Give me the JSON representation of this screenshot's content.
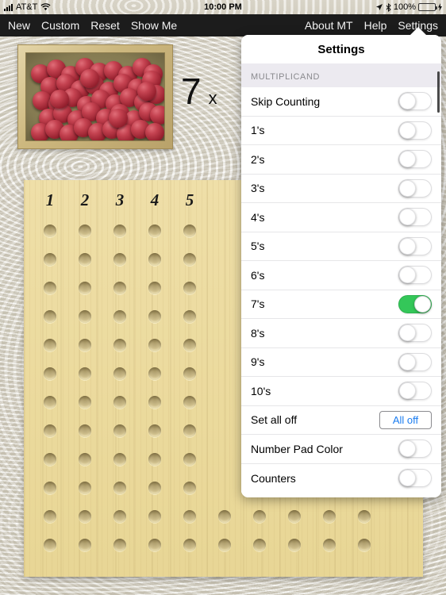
{
  "statusbar": {
    "signal_icon": "cellular-bars-icon",
    "carrier": "AT&T",
    "wifi_icon": "wifi-icon",
    "time": "10:00 PM",
    "location_icon": "location-arrow-icon",
    "bluetooth_icon": "bluetooth-icon",
    "battery_percent": "100%",
    "battery_icon": "battery-icon",
    "charging_icon": "lightning-bolt-icon"
  },
  "toolbar": {
    "left_items": [
      {
        "label": "New",
        "name": "new-button"
      },
      {
        "label": "Custom",
        "name": "custom-button"
      },
      {
        "label": "Reset",
        "name": "reset-button"
      },
      {
        "label": "Show Me",
        "name": "show-me-button"
      }
    ],
    "right_items": [
      {
        "label": "About MT",
        "name": "about-mt-button"
      },
      {
        "label": "Help",
        "name": "help-button"
      },
      {
        "label": "Settings",
        "name": "settings-button"
      }
    ]
  },
  "workspace": {
    "tray_name": "marble-tray",
    "multiplicand": "7",
    "operator": "x",
    "pegboard": {
      "column_labels": [
        "1",
        "2",
        "3",
        "4",
        "5"
      ],
      "columns": 10,
      "rows": 12
    }
  },
  "settings": {
    "title": "Settings",
    "section_header": "MULTIPLICAND",
    "rows": [
      {
        "label": "Skip Counting",
        "on": false,
        "name": "toggle-skip-counting"
      },
      {
        "label": "1's",
        "on": false,
        "name": "toggle-1s"
      },
      {
        "label": "2's",
        "on": false,
        "name": "toggle-2s"
      },
      {
        "label": "3's",
        "on": false,
        "name": "toggle-3s"
      },
      {
        "label": "4's",
        "on": false,
        "name": "toggle-4s"
      },
      {
        "label": "5's",
        "on": false,
        "name": "toggle-5s"
      },
      {
        "label": "6's",
        "on": false,
        "name": "toggle-6s"
      },
      {
        "label": "7's",
        "on": true,
        "name": "toggle-7s"
      },
      {
        "label": "8's",
        "on": false,
        "name": "toggle-8s"
      },
      {
        "label": "9's",
        "on": false,
        "name": "toggle-9s"
      },
      {
        "label": "10's",
        "on": false,
        "name": "toggle-10s"
      }
    ],
    "set_all_off": {
      "label": "Set all off",
      "button_label": "All off"
    },
    "extra_rows": [
      {
        "label": "Number Pad Color",
        "on": false,
        "name": "toggle-number-pad-color"
      },
      {
        "label": "Counters",
        "on": false,
        "name": "toggle-counters"
      }
    ]
  },
  "colors": {
    "toggle_on": "#34c759",
    "link": "#1a7cf0",
    "toolbar_bg": "#1c1c1c",
    "marble": "#c44250",
    "pegboard": "#ecdb9f"
  }
}
